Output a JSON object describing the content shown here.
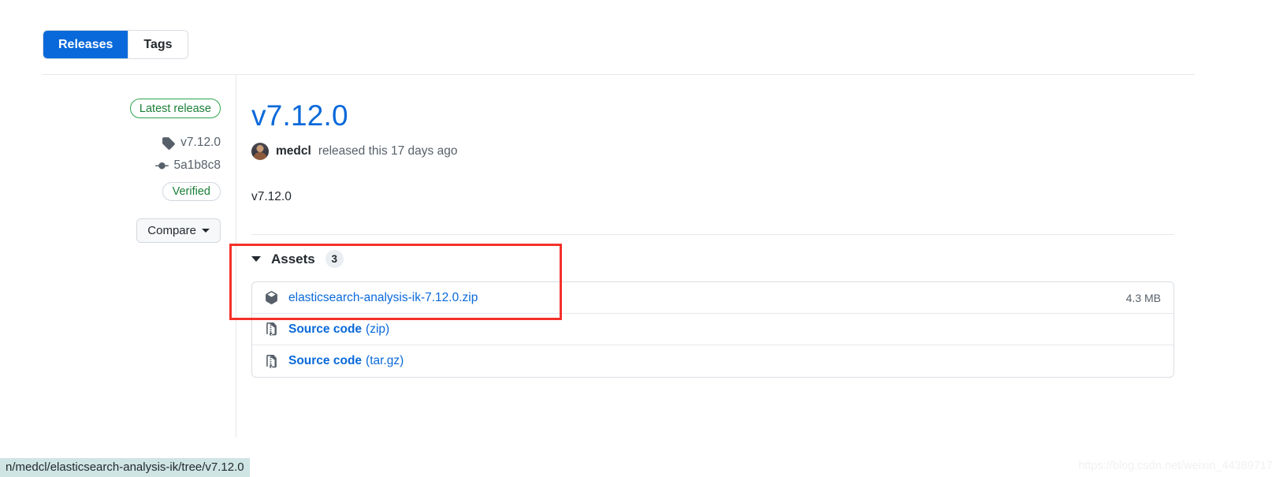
{
  "tabs": [
    {
      "label": "Releases",
      "selected": true
    },
    {
      "label": "Tags",
      "selected": false
    }
  ],
  "sidebar": {
    "latest_release_badge": "Latest release",
    "tag_name": "v7.12.0",
    "commit_sha": "5a1b8c8",
    "verified_badge": "Verified",
    "compare_button": "Compare"
  },
  "release": {
    "title": "v7.12.0",
    "author": "medcl",
    "byline_suffix": "released this 17 days ago",
    "body": "v7.12.0"
  },
  "assets": {
    "heading": "Assets",
    "count": "3",
    "items": [
      {
        "name": "elasticsearch-analysis-ik-7.12.0.zip",
        "suffix": "",
        "size": "4.3 MB",
        "icon": "package-icon",
        "bold": false
      },
      {
        "name": "Source code",
        "suffix": "(zip)",
        "size": "",
        "icon": "file-zip-icon",
        "bold": true
      },
      {
        "name": "Source code",
        "suffix": "(tar.gz)",
        "size": "",
        "icon": "file-zip-icon",
        "bold": true
      }
    ]
  },
  "status_bar": {
    "url": "n/medcl/elasticsearch-analysis-ik/tree/v7.12.0"
  },
  "watermark": {
    "text": "https://blog.csdn.net/weixin_44389717"
  },
  "colors": {
    "accent_blue": "#0969da",
    "green": "#1a7f37",
    "annotation_red": "#f4312a",
    "status_bar_bg": "#cfe5e4"
  }
}
